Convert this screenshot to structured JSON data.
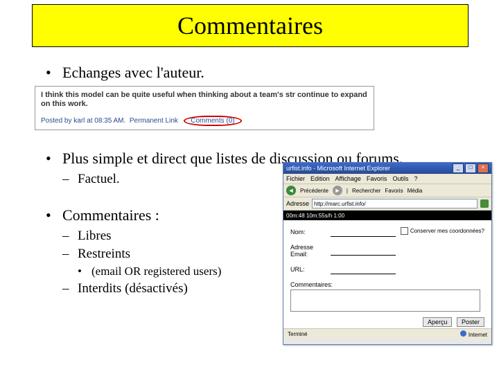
{
  "title": "Commentaires",
  "bullets": {
    "b1": "Echanges avec l'auteur.",
    "b2": "Plus simple et direct que listes de discussion ou forums.",
    "b2_sub1": "Factuel.",
    "b3": "Commentaires :",
    "b3_sub1": "Libres",
    "b3_sub2": "Restreints",
    "b3_sub2_sub1": "(email OR registered users)",
    "b3_sub3": "Interdits (désactivés)"
  },
  "blog": {
    "text": "I think this model can be quite useful when thinking about a team's str continue to expand on this work.",
    "posted_by": "Posted by karl at 08:35 AM.",
    "permalink": "Permanent Link",
    "comments": "Comments (0)"
  },
  "browser": {
    "window_title": "urfist.info - Microsoft Internet Explorer",
    "menu": {
      "file": "Fichier",
      "edit": "Edition",
      "view": "Affichage",
      "fav": "Favoris",
      "tools": "Outils",
      "help": "?"
    },
    "toolbar": {
      "back": "Précédente",
      "search": "Rechercher",
      "fav": "Favoris",
      "media": "Média"
    },
    "address_label": "Adresse",
    "address_value": "http://marc.urfist.info/",
    "blackbar": "00m:48 10m:55s/h 1:00",
    "form": {
      "name_label": "Nom:",
      "email_label": "Adresse Email:",
      "url_label": "URL:",
      "comment_label": "Commentaires:",
      "remember_label": "Conserver mes coordonnées?",
      "preview": "Aperçu",
      "submit": "Poster"
    },
    "status_left": "Terminé",
    "status_right": "Internet"
  }
}
